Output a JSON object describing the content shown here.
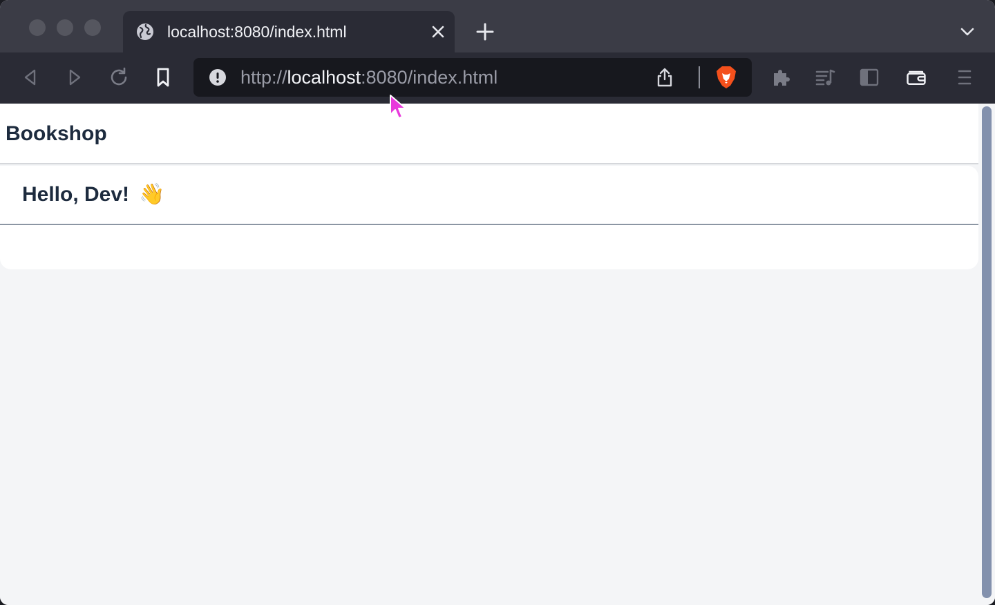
{
  "browser": {
    "tab": {
      "title": "localhost:8080/index.html"
    },
    "url": {
      "scheme": "http://",
      "host": "localhost",
      "rest": ":8080/index.html"
    },
    "colors": {
      "brave_orange": "#f4501c",
      "cursor": "#e83adb"
    }
  },
  "app": {
    "title": "Bookshop",
    "greeting": "Hello, Dev!",
    "greeting_emoji": "👋"
  }
}
